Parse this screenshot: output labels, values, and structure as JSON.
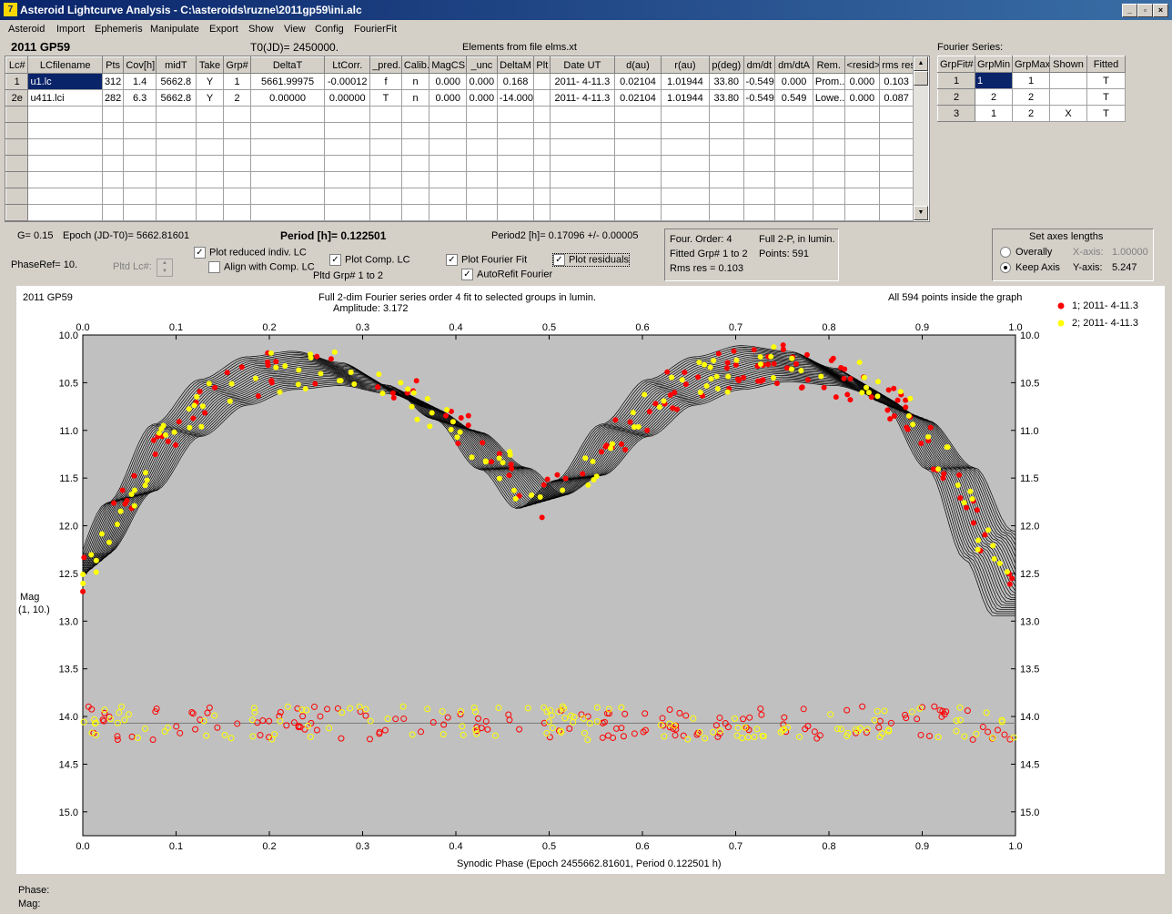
{
  "window": {
    "title": "Asteroid Lightcurve Analysis - C:\\asteroids\\ruzne\\2011gp59\\ini.alc",
    "icon": "app-icon"
  },
  "menu": [
    "Asteroid",
    "Import",
    "Ephemeris",
    "Manipulate",
    "Export",
    "Show",
    "View",
    "Config",
    "FourierFit"
  ],
  "header": {
    "asteroid": "2011 GP59",
    "t0": "T0(JD)= 2450000.",
    "elements": "Elements from file elms.xt",
    "fourier_title": "Fourier Series:"
  },
  "lc_table": {
    "columns": [
      "Lc#",
      "LCfilename",
      "Pts",
      "Cov[h]",
      "midT",
      "Take",
      "Grp#",
      "DeltaT",
      "LtCorr.",
      "_pred.",
      "Calib.",
      "MagCS",
      "_unc",
      "DeltaM",
      "Plt",
      "Date UT",
      "d(au)",
      "r(au)",
      "p(deg)",
      "dm/dt",
      "dm/dtA",
      "Rem.",
      "<resid>",
      "rms res"
    ],
    "rows": [
      [
        "1",
        "u1.lc",
        "312",
        "1.4",
        "5662.8",
        "Y",
        "1",
        "5661.99975",
        "-0.00012",
        "f",
        "n",
        "0.000",
        "0.000",
        "0.168",
        "",
        "2011- 4-11.3",
        "0.02104",
        "1.01944",
        "33.80",
        "-0.549",
        "0.000",
        "Prom..",
        "0.000",
        "0.103"
      ],
      [
        "2e",
        "u411.lci",
        "282",
        "6.3",
        "5662.8",
        "Y",
        "2",
        "0.00000",
        "0.00000",
        "T",
        "n",
        "0.000",
        "0.000",
        "-14.000",
        "",
        "2011- 4-11.3",
        "0.02104",
        "1.01944",
        "33.80",
        "-0.549",
        "0.549",
        "Lowe..",
        "0.000",
        "0.087"
      ]
    ]
  },
  "fourier_table": {
    "columns": [
      "GrpFit#",
      "GrpMin",
      "GrpMax",
      "Shown",
      "Fitted"
    ],
    "rows": [
      [
        "1",
        "1",
        "1",
        "",
        "T"
      ],
      [
        "2",
        "2",
        "2",
        "",
        "T"
      ],
      [
        "3",
        "1",
        "2",
        "X",
        "T"
      ]
    ]
  },
  "info": {
    "g": "G= 0.15",
    "epoch": "Epoch (JD-T0)= 5662.81601",
    "period": "Period [h]= 0.122501",
    "period2": "Period2 [h]= 0.17096 +/- 0.00005",
    "phaseref": "PhaseRef= 10.",
    "pltd_lc": "Pltd Lc#:",
    "pltd_grp": "Pltd Grp#  1   to   2",
    "four_order": "Four. Order:  4",
    "full2p": "Full 2-P,  in lumin.",
    "fitted_grp": "Fitted Grp# 1 to 2",
    "points": "Points: 591",
    "rms": "Rms res      = 0.103"
  },
  "checkboxes": [
    {
      "label": "Plot reduced indiv. LC",
      "checked": true
    },
    {
      "label": "Align with Comp. LC",
      "checked": false
    },
    {
      "label": "Plot Comp. LC",
      "checked": true
    },
    {
      "label": "Plot Fourier Fit",
      "checked": true
    },
    {
      "label": "Plot residuals",
      "checked": true
    },
    {
      "label": "AutoRefit Fourier",
      "checked": true
    }
  ],
  "axes_box": {
    "title": "Set axes lengths",
    "overally": "Overally",
    "keep": "Keep Axis",
    "xaxis_label": "X-axis:",
    "xaxis_value": "1.00000",
    "yaxis_label": "Y-axis:",
    "yaxis_value": "5.247"
  },
  "status": {
    "phase": "Phase:",
    "mag": "Mag:"
  },
  "chart_data": {
    "type": "scatter",
    "title": "Full 2-dim Fourier series order 4 fit to selected groups in lumin.",
    "subtitle": "Amplitude: 3.172",
    "label_left": "2011 GP59",
    "label_right": "All 594 points inside the graph",
    "xlabel": "Synodic Phase (Epoch 2455662.81601, Period 0.122501 h)",
    "ylabel": "Mag",
    "ylabel2": "(1, 10.)",
    "xlim": [
      0,
      1
    ],
    "ylim": [
      10,
      15.25
    ],
    "y_inverted": true,
    "xticks": [
      "0.0",
      "0.1",
      "0.2",
      "0.3",
      "0.4",
      "0.5",
      "0.6",
      "0.7",
      "0.8",
      "0.9",
      "1.0"
    ],
    "yticks": [
      "10.0",
      "10.5",
      "11.0",
      "11.5",
      "12.0",
      "12.5",
      "13.0",
      "13.5",
      "14.0",
      "14.5",
      "15.0"
    ],
    "residual_level": 14.07,
    "fourier_mean_curve": [
      [
        0,
        12.5
      ],
      [
        0.05,
        11.7
      ],
      [
        0.1,
        11.0
      ],
      [
        0.15,
        10.6
      ],
      [
        0.2,
        10.4
      ],
      [
        0.25,
        10.35
      ],
      [
        0.3,
        10.45
      ],
      [
        0.35,
        10.65
      ],
      [
        0.4,
        10.95
      ],
      [
        0.45,
        11.4
      ],
      [
        0.49,
        11.75
      ],
      [
        0.53,
        11.5
      ],
      [
        0.58,
        11.0
      ],
      [
        0.63,
        10.6
      ],
      [
        0.68,
        10.4
      ],
      [
        0.73,
        10.3
      ],
      [
        0.78,
        10.35
      ],
      [
        0.83,
        10.5
      ],
      [
        0.88,
        10.8
      ],
      [
        0.93,
        11.4
      ],
      [
        0.97,
        12.2
      ],
      [
        1.0,
        12.7
      ]
    ],
    "series": [
      {
        "name": "1; 2011- 4-11.3",
        "color": "#ff0000"
      },
      {
        "name": "2; 2011- 4-11.3",
        "color": "#ffff00"
      }
    ]
  }
}
